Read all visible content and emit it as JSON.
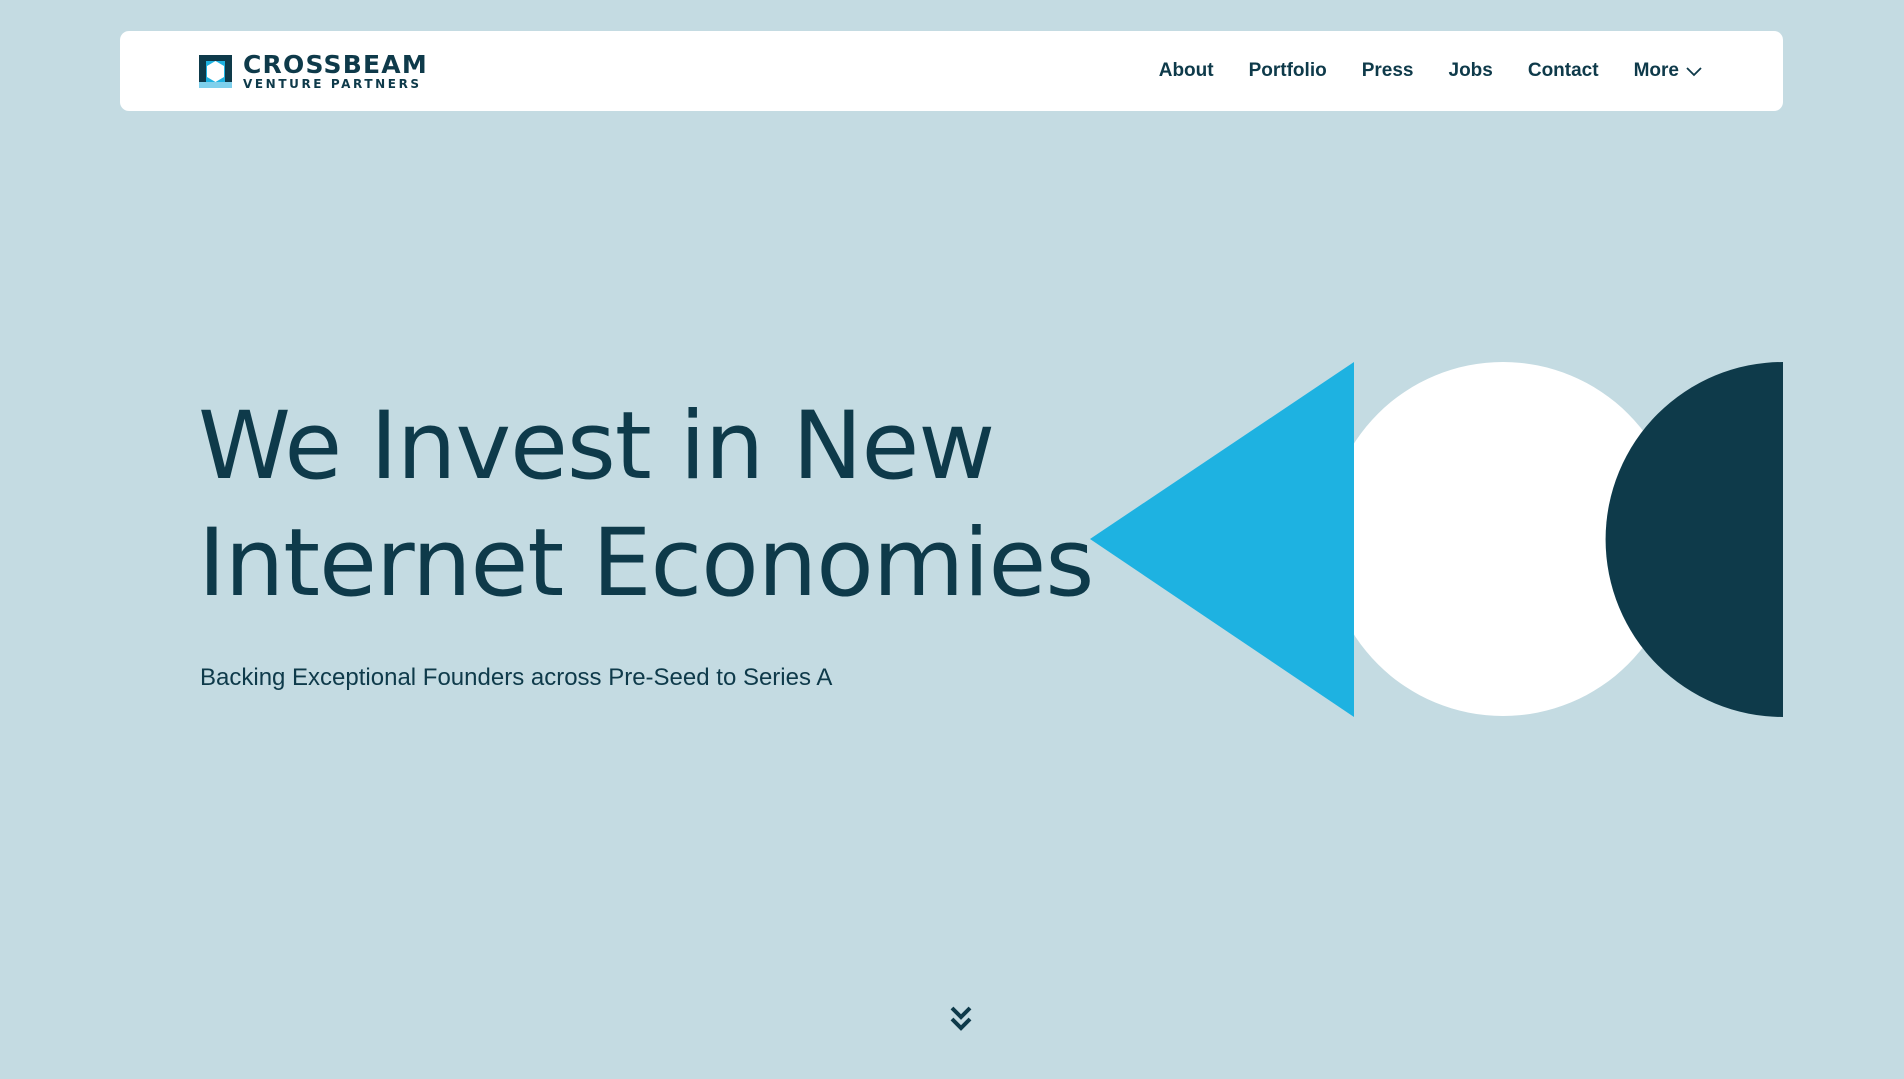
{
  "header": {
    "logo": {
      "name": "CROSSBEAM",
      "subtitle": "VENTURE PARTNERS"
    },
    "nav": [
      {
        "label": "About"
      },
      {
        "label": "Portfolio"
      },
      {
        "label": "Press"
      },
      {
        "label": "Jobs"
      },
      {
        "label": "Contact"
      },
      {
        "label": "More",
        "icon": "chevron-down-icon"
      }
    ]
  },
  "hero": {
    "title_line1": "We Invest in New",
    "title_line2": "Internet Economies",
    "subtitle": "Backing Exceptional Founders across Pre-Seed to Series A",
    "scroll_icon": "double-chevron-down-icon"
  },
  "colors": {
    "background": "#c4dbe2",
    "primary_dark": "#0e3a4a",
    "accent_blue": "#1eb2e1",
    "white": "#ffffff"
  }
}
